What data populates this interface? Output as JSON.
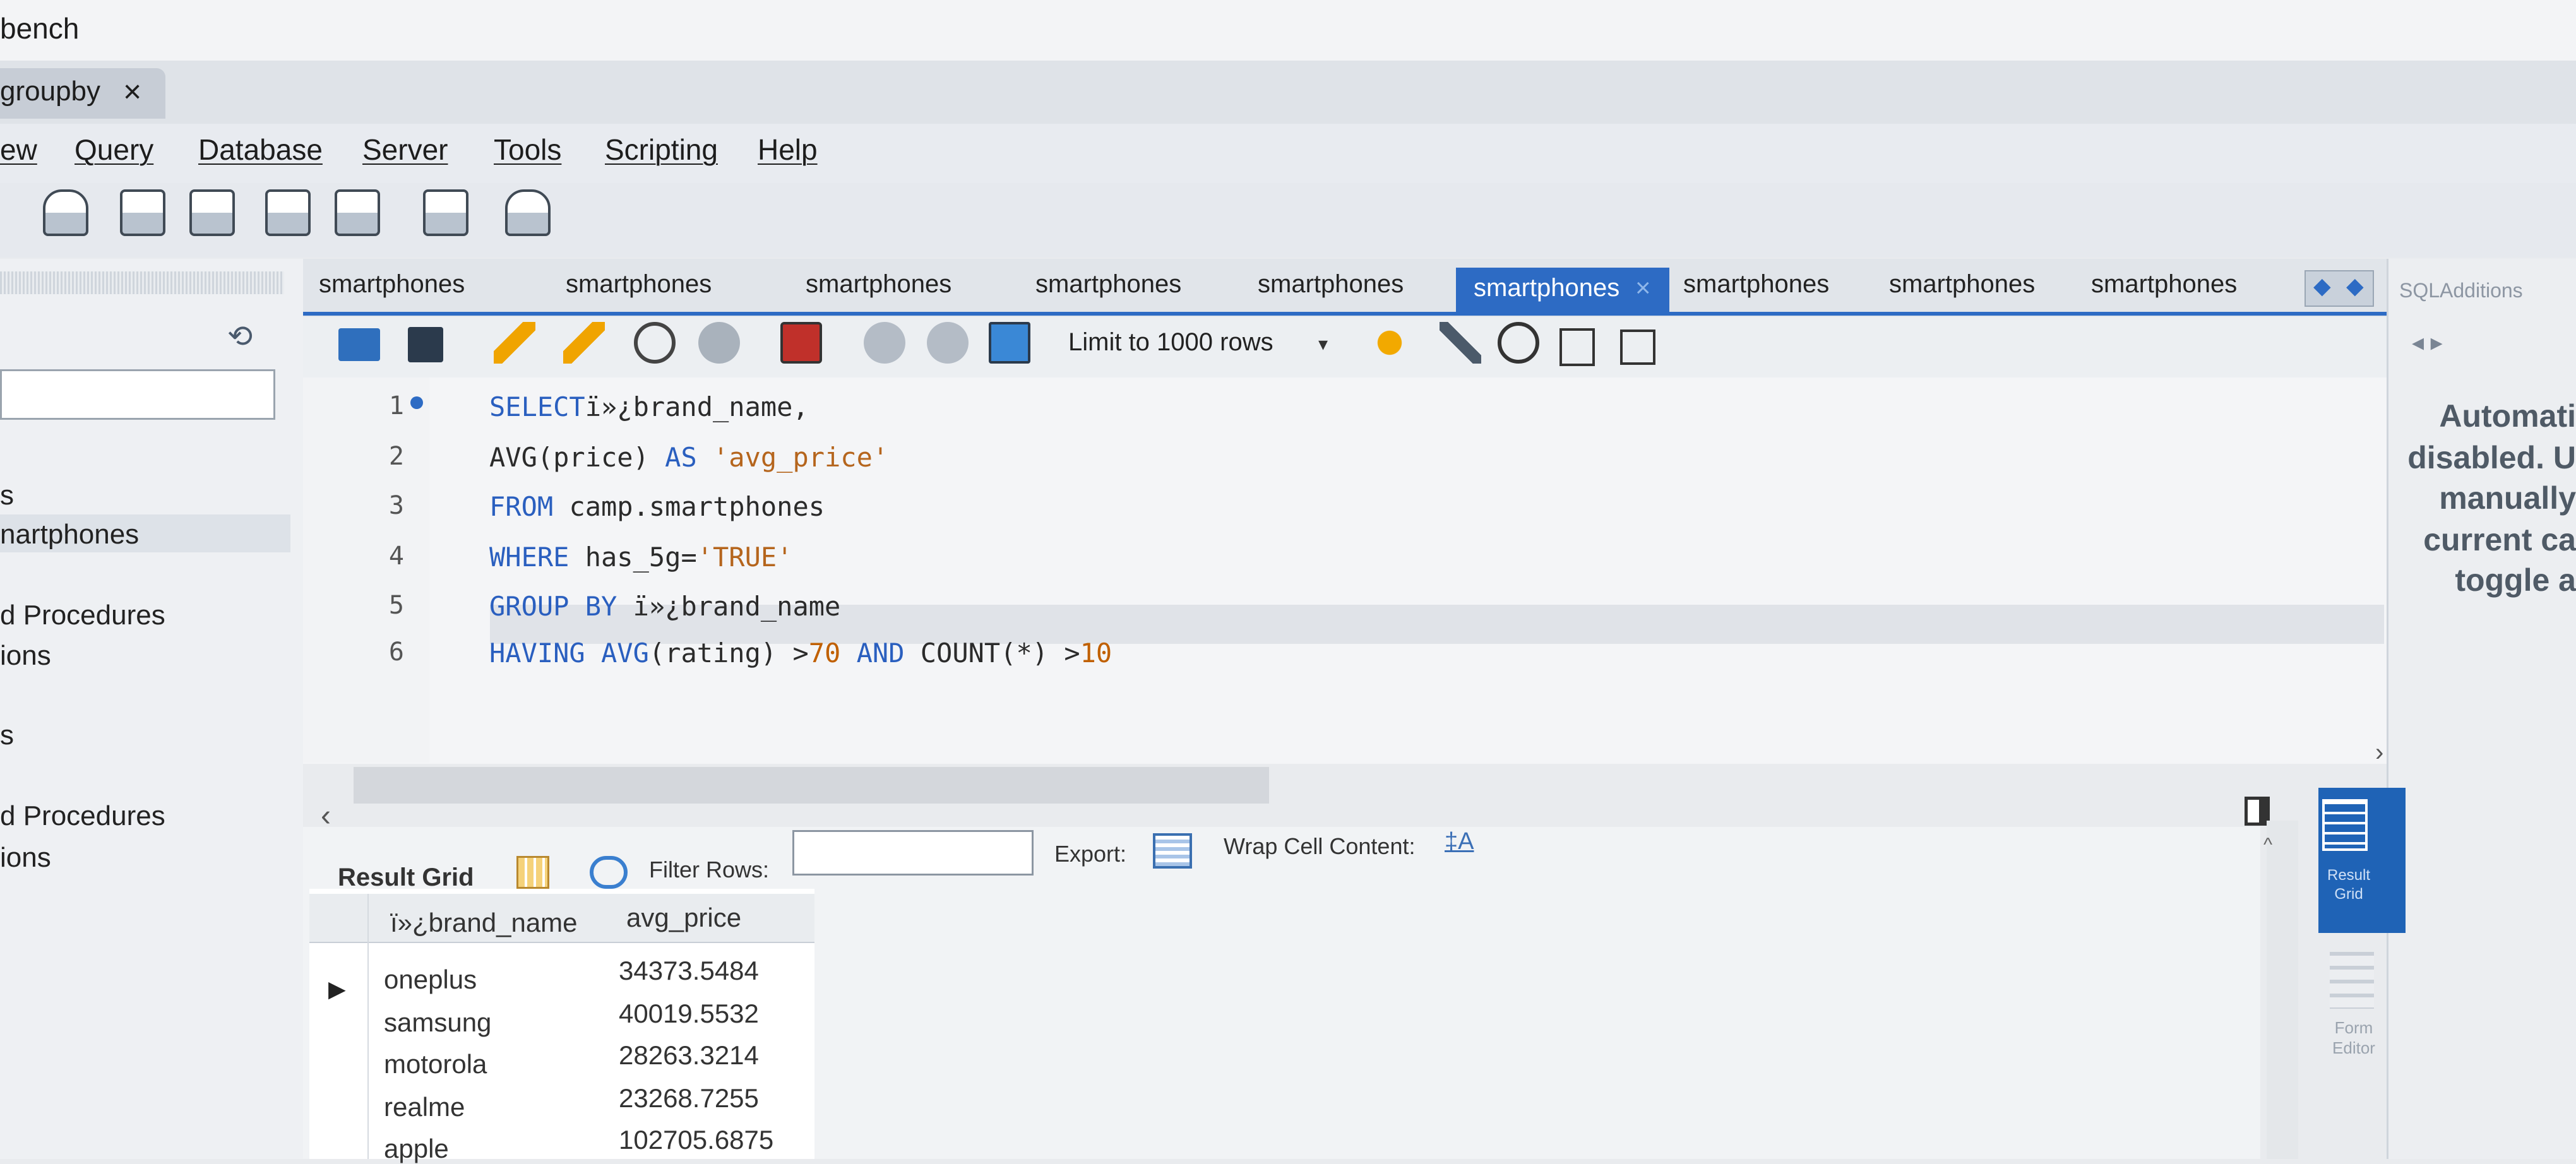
{
  "window": {
    "title_fragment": "bench",
    "conn_tab": "groupby",
    "conn_tab_close": "×"
  },
  "menu": [
    "ew",
    "Query",
    "Database",
    "Server",
    "Tools",
    "Scripting",
    "Help"
  ],
  "sql_tabs": {
    "labels": [
      "smartphones",
      "smartphones",
      "smartphones",
      "smartphones",
      "smartphones",
      "smartphones",
      "smartphones",
      "smartphones",
      "smartphones"
    ],
    "active_index": 5,
    "close_glyph": "×",
    "scroll_left": "◆",
    "scroll_right": "◆"
  },
  "sidebar": {
    "refresh_icon": "⟲",
    "items": [
      "s",
      "nartphones",
      "d Procedures",
      "ions",
      "s",
      "d Procedures",
      "ions"
    ]
  },
  "editor_toolbar": {
    "limit_label": "Limit to 1000 rows",
    "limit_caret": "▾"
  },
  "editor": {
    "lines": [
      {
        "n": "1",
        "tokens": [
          [
            "kw",
            "SELECT"
          ],
          [
            "",
            "ï»¿brand_name,"
          ]
        ]
      },
      {
        "n": "2",
        "tokens": [
          [
            "",
            "AVG(price) "
          ],
          [
            "kw",
            "AS"
          ],
          [
            "str",
            " 'avg_price'"
          ]
        ]
      },
      {
        "n": "3",
        "tokens": [
          [
            "kw",
            "FROM"
          ],
          [
            "",
            " camp.smartphones"
          ]
        ]
      },
      {
        "n": "4",
        "tokens": [
          [
            "kw",
            "WHERE"
          ],
          [
            "",
            " has_5g="
          ],
          [
            "str",
            "'TRUE'"
          ]
        ]
      },
      {
        "n": "5",
        "tokens": [
          [
            "kw",
            "GROUP BY"
          ],
          [
            "",
            " ï»¿brand_name"
          ]
        ]
      },
      {
        "n": "6",
        "tokens": [
          [
            "kw",
            "HAVING"
          ],
          [
            "",
            " "
          ],
          [
            "kw",
            "AVG"
          ],
          [
            "",
            "(rating) >"
          ],
          [
            "num",
            "70"
          ],
          [
            "",
            " "
          ],
          [
            "kw",
            "AND"
          ],
          [
            "",
            " COUNT(*) >"
          ],
          [
            "num",
            "10"
          ]
        ]
      }
    ],
    "scroll_right": "›",
    "scroll_left": "‹"
  },
  "right_panel": {
    "title": "SQLAdditions",
    "nav": "◂  ▸",
    "text": [
      "Automati",
      "disabled. U",
      "manually",
      "current ca",
      "toggle a"
    ]
  },
  "result": {
    "grid_label": "Result Grid",
    "filter_label": "Filter Rows:",
    "filter_value": "",
    "export_label": "Export:",
    "wrap_label": "Wrap Cell Content:",
    "wrap_icon": "‡A",
    "columns": [
      "ï»¿brand_name",
      "avg_price"
    ],
    "rows": [
      [
        "oneplus",
        "34373.5484"
      ],
      [
        "samsung",
        "40019.5532"
      ],
      [
        "motorola",
        "28263.3214"
      ],
      [
        "realme",
        "23268.7255"
      ],
      [
        "apple",
        "102705.6875"
      ]
    ],
    "row_arrow": "▶",
    "side_buttons": [
      {
        "label_1": "Result",
        "label_2": "Grid"
      },
      {
        "label_1": "Form",
        "label_2": "Editor"
      }
    ]
  }
}
